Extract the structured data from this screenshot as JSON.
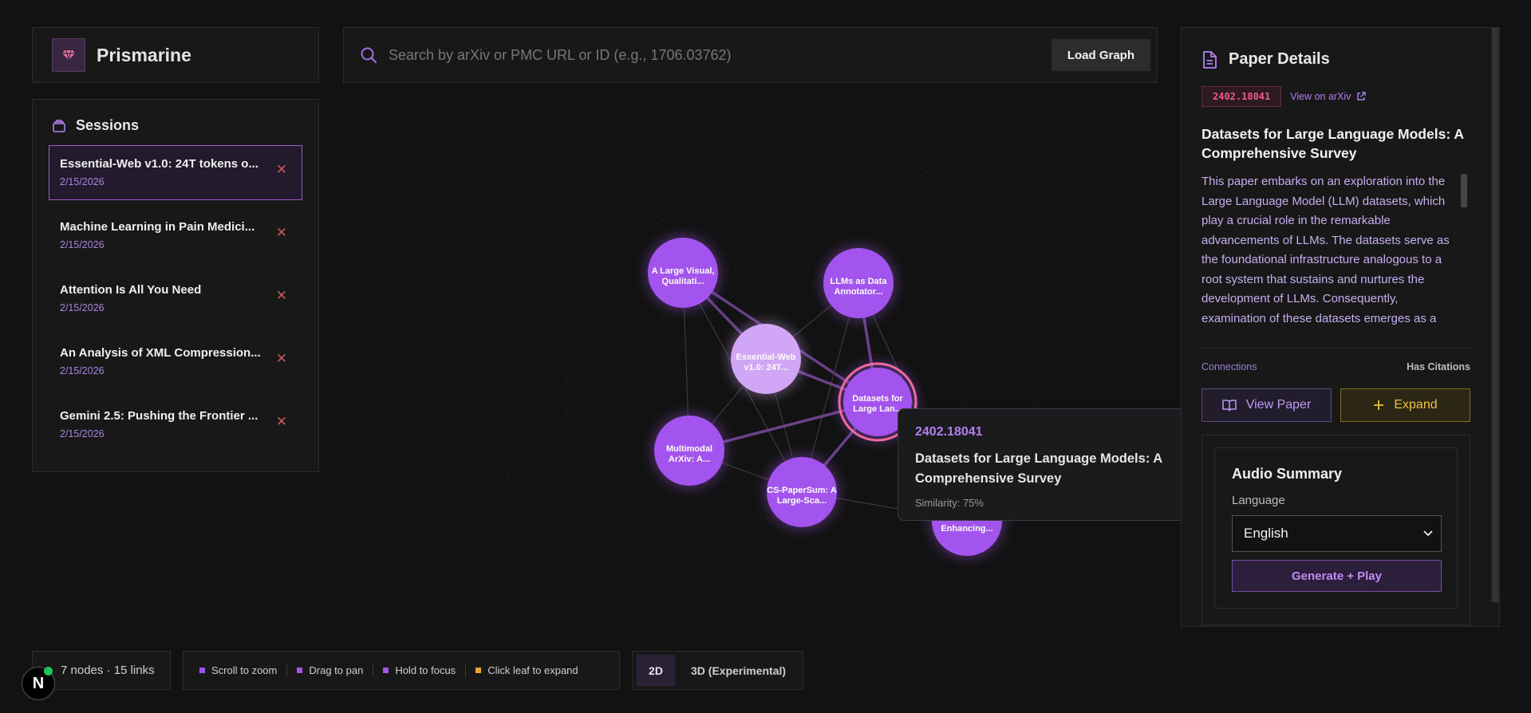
{
  "brand": {
    "name": "Prismarine"
  },
  "sessions": {
    "heading": "Sessions",
    "items": [
      {
        "title": "Essential-Web v1.0: 24T tokens o...",
        "date": "2/15/2026",
        "active": true
      },
      {
        "title": "Machine Learning in Pain Medici...",
        "date": "2/15/2026",
        "active": false
      },
      {
        "title": "Attention Is All You Need",
        "date": "2/15/2026",
        "active": false
      },
      {
        "title": "An Analysis of XML Compression...",
        "date": "2/15/2026",
        "active": false
      },
      {
        "title": "Gemini 2.5: Pushing the Frontier ...",
        "date": "2/15/2026",
        "active": false
      }
    ],
    "remove_glyph": "✕"
  },
  "search": {
    "placeholder": "Search by arXiv or PMC URL or ID (e.g., 1706.03762)",
    "value": "",
    "load_label": "Load Graph"
  },
  "graph": {
    "nodes": [
      {
        "label1": "A Large Visual,",
        "label2": "Qualitati..."
      },
      {
        "label1": "LLMs as Data",
        "label2": "Annotator..."
      },
      {
        "label1": "Essential-Web",
        "label2": "v1.0: 24T..."
      },
      {
        "label1": "Datasets for",
        "label2": "Large Lan..."
      },
      {
        "label1": "Multimodal",
        "label2": "ArXiv: A..."
      },
      {
        "label1": "CS-PaperSum: A",
        "label2": "Large-Sca..."
      },
      {
        "label1": "",
        "label2": "Enhancing..."
      }
    ],
    "colors": {
      "node": "#a454ee",
      "node_light": "#d2a6f6",
      "selected_ring": "#f06aa0"
    }
  },
  "tooltip": {
    "id": "2402.18041",
    "title": "Datasets for Large Language Models: A Comprehensive Survey",
    "similarity": "Similarity: 75%"
  },
  "details": {
    "heading": "Paper Details",
    "arxiv_id": "2402.18041",
    "arxiv_link": "View on arXiv",
    "title": "Datasets for Large Language Models: A Comprehensive Survey",
    "abstract": "This paper embarks on an exploration into the Large Language Model (LLM) datasets, which play a crucial role in the remarkable advancements of LLMs. The datasets serve as the foundational infrastructure analogous to a root system that sustains and nurtures the development of LLMs. Consequently, examination of these datasets emerges as a",
    "connections_label": "Connections",
    "connections_value": "Has Citations",
    "view_label": "View Paper",
    "expand_label": "Expand",
    "audio": {
      "title": "Audio Summary",
      "language_label": "Language",
      "language_value": "English",
      "generate_label": "Generate + Play"
    }
  },
  "footer": {
    "stats": "7 nodes · 15 links",
    "hints": [
      {
        "label": "Scroll to zoom",
        "color": "#a454ee"
      },
      {
        "label": "Drag to pan",
        "color": "#a454ee"
      },
      {
        "label": "Hold to focus",
        "color": "#a454ee"
      },
      {
        "label": "Click leaf to expand",
        "color": "#f0a030"
      }
    ],
    "mode_2d": "2D",
    "mode_3d": "3D (Experimental)"
  },
  "badge": {
    "letter": "N"
  }
}
